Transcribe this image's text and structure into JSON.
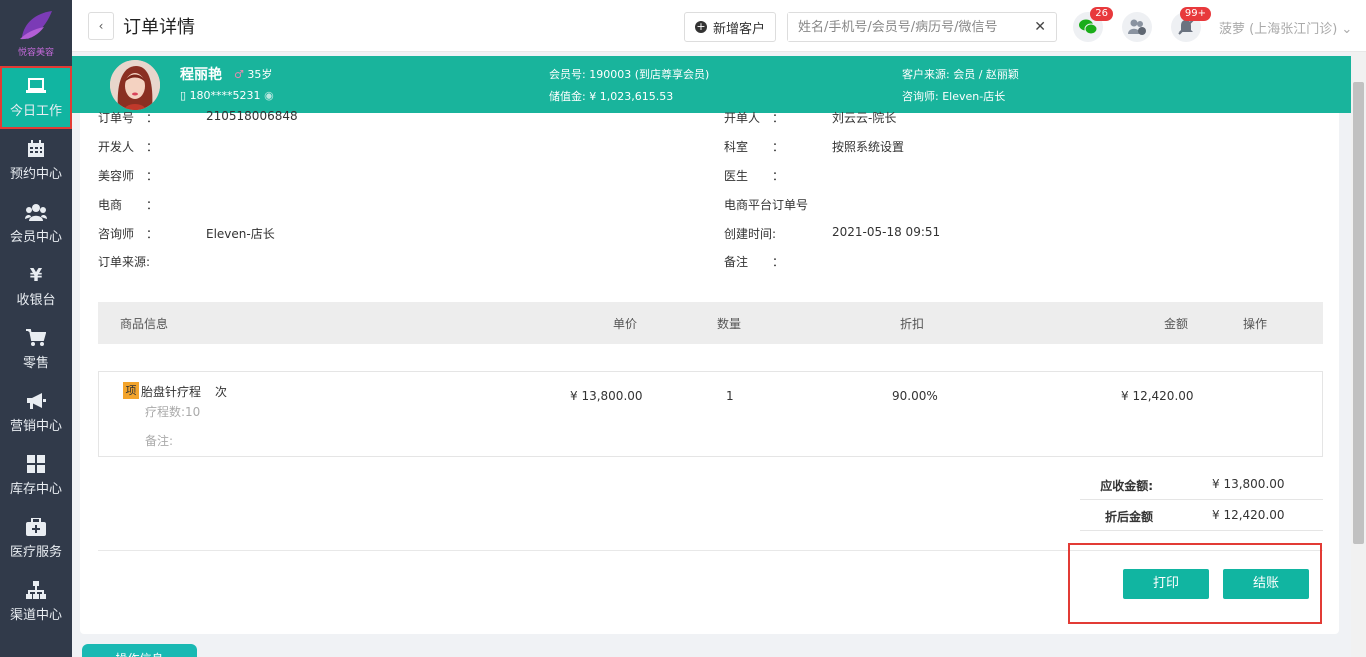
{
  "sidebar": {
    "logo_text": "悦容美容",
    "items": [
      {
        "label": "今日工作",
        "icon": "monitor-icon"
      },
      {
        "label": "预约中心",
        "icon": "calendar-icon"
      },
      {
        "label": "会员中心",
        "icon": "members-icon"
      },
      {
        "label": "收银台",
        "icon": "yen-icon"
      },
      {
        "label": "零售",
        "icon": "cart-icon"
      },
      {
        "label": "营销中心",
        "icon": "megaphone-icon"
      },
      {
        "label": "库存中心",
        "icon": "grid-icon"
      },
      {
        "label": "医疗服务",
        "icon": "medkit-icon"
      },
      {
        "label": "渠道中心",
        "icon": "sitemap-icon"
      }
    ]
  },
  "header": {
    "title": "订单详情",
    "add_customer": "新增客户",
    "search_placeholder": "姓名/手机号/会员号/病历号/微信号",
    "wechat_badge": "26",
    "notify_badge": "99+",
    "user": "菠萝 (上海张江门诊)"
  },
  "member": {
    "name": "程丽艳",
    "age": "35岁",
    "phone": "180****5231",
    "member_no_label": "会员号:",
    "member_no": "190003 (到店尊享会员)",
    "balance_label": "储值金:",
    "balance": "¥ 1,023,615.53",
    "source_label": "客户来源:",
    "source": "会员 / 赵丽颖",
    "consultant_label": "咨询师:",
    "consultant": "Eleven-店长"
  },
  "order": {
    "left": [
      {
        "label": "订单号　：",
        "value": "210518006848"
      },
      {
        "label": "开发人　：",
        "value": ""
      },
      {
        "label": "美容师　：",
        "value": ""
      },
      {
        "label": "电商　　：",
        "value": ""
      },
      {
        "label": "咨询师　：",
        "value": "Eleven-店长"
      },
      {
        "label": "订单来源:",
        "value": ""
      }
    ],
    "right": [
      {
        "label": "开单人　：",
        "value": "刘云云-院长"
      },
      {
        "label": "科室　　：",
        "value": "按照系统设置"
      },
      {
        "label": "医生　　：",
        "value": ""
      },
      {
        "label": "电商平台订单号",
        "value": ""
      },
      {
        "label": "创建时间:",
        "value": "2021-05-18 09:51"
      },
      {
        "label": "备注　　：",
        "value": ""
      }
    ]
  },
  "table": {
    "headers": [
      "商品信息",
      "单价",
      "数量",
      "折扣",
      "金额",
      "操作"
    ],
    "row": {
      "tag": "项",
      "name": "胎盘针疗程",
      "unit": "次",
      "course": "疗程数:10",
      "remark": "备注:",
      "price": "¥ 13,800.00",
      "qty": "1",
      "discount": "90.00%",
      "amount": "¥ 12,420.00"
    }
  },
  "summary": {
    "receivable_label": "应收金额:",
    "receivable": "¥ 13,800.00",
    "discounted_label": "折后金额",
    "discounted": "¥ 12,420.00"
  },
  "actions": {
    "print": "打印",
    "checkout": "结账"
  },
  "bottom_tab": "操作信息",
  "colors": {
    "teal": "#19b49c",
    "sidebar": "#313a4a",
    "highlight": "#e23b35"
  }
}
